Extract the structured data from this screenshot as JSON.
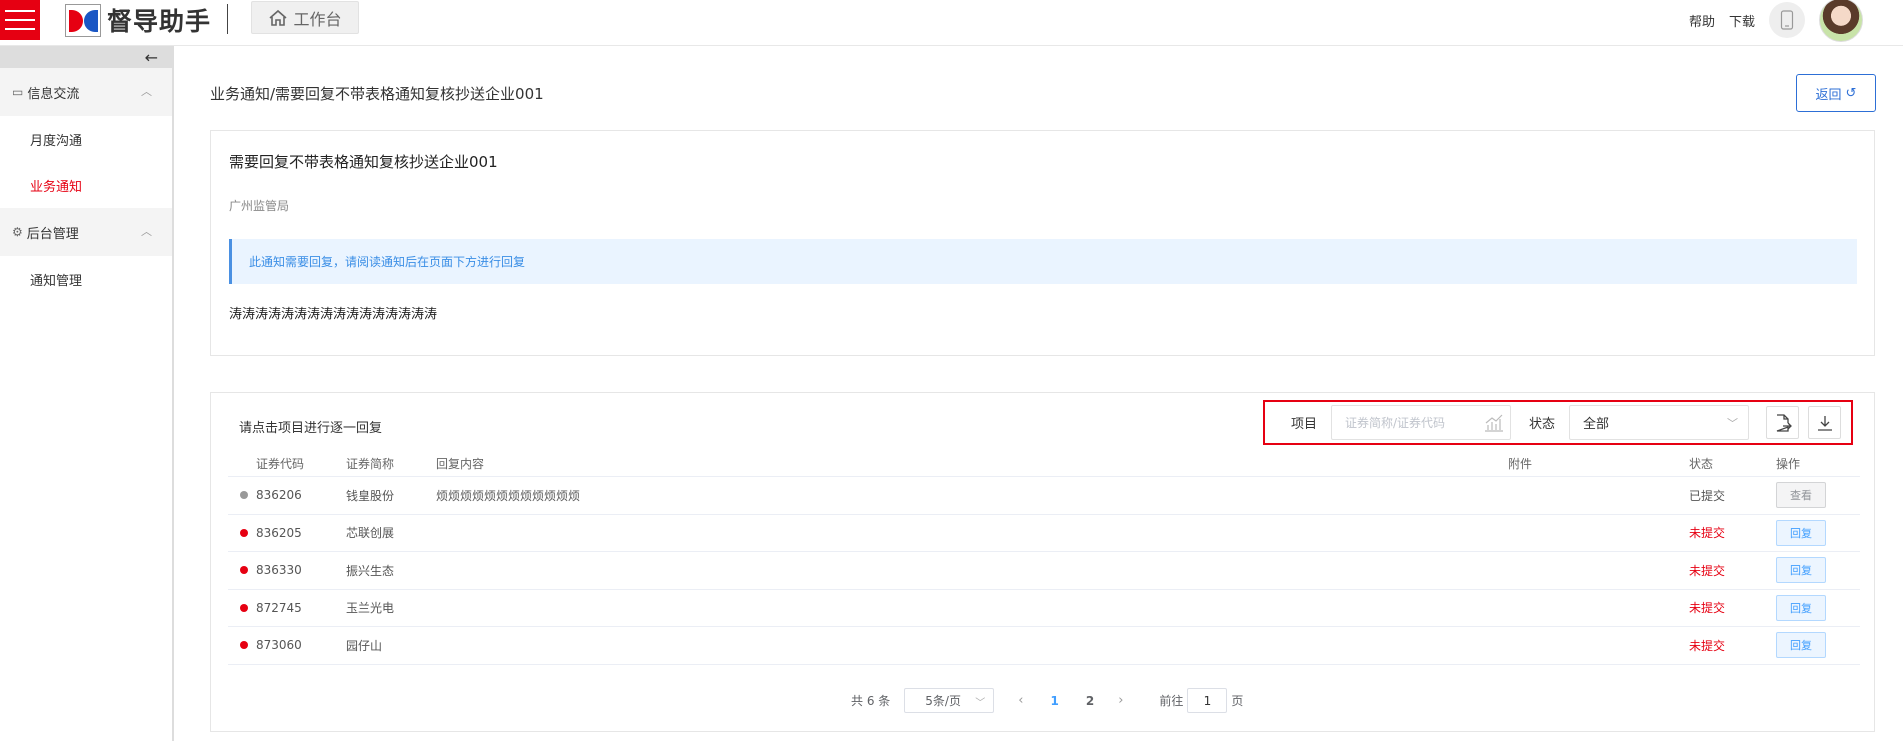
{
  "header": {
    "app_name": "督导助手",
    "home_tab": "工作台",
    "help": "帮助",
    "download": "下载"
  },
  "sidebar": {
    "groups": [
      {
        "label": "信息交流",
        "items": [
          {
            "label": "月度沟通"
          },
          {
            "label": "业务通知",
            "active": true
          }
        ]
      },
      {
        "label": "后台管理",
        "items": [
          {
            "label": "通知管理"
          }
        ]
      }
    ]
  },
  "page": {
    "breadcrumb": "业务通知/需要回复不带表格通知复核抄送企业001",
    "back_label": "返回"
  },
  "notice": {
    "title": "需要回复不带表格通知复核抄送企业001",
    "org": "广州监管局",
    "alert": "此通知需要回复，请阅读通知后在页面下方进行回复",
    "body": "涛涛涛涛涛涛涛涛涛涛涛涛涛涛涛涛"
  },
  "reply": {
    "tip": "请点击项目进行逐一回复",
    "filter": {
      "project_label": "项目",
      "project_placeholder": "证券简称/证券代码",
      "status_label": "状态",
      "status_value": "全部"
    },
    "columns": {
      "code": "证券代码",
      "name": "证券简称",
      "content": "回复内容",
      "attach": "附件",
      "status": "状态",
      "op": "操作"
    },
    "rows": [
      {
        "code": "836206",
        "name": "钱皇股份",
        "content": "烦烦烦烦烦烦烦烦烦烦烦烦",
        "status": "已提交",
        "op": "查看"
      },
      {
        "code": "836205",
        "name": "芯联创展",
        "content": "",
        "status": "未提交",
        "op": "回复"
      },
      {
        "code": "836330",
        "name": "振兴生态",
        "content": "",
        "status": "未提交",
        "op": "回复"
      },
      {
        "code": "872745",
        "name": "玉兰光电",
        "content": "",
        "status": "未提交",
        "op": "回复"
      },
      {
        "code": "873060",
        "name": "园仔山",
        "content": "",
        "status": "未提交",
        "op": "回复"
      }
    ],
    "pager": {
      "total": "共 6 条",
      "page_size": "5条/页",
      "pages": [
        "1",
        "2"
      ],
      "current": "1",
      "goto_label": "前往",
      "goto_value": "1",
      "goto_unit": "页"
    }
  },
  "colors": {
    "brand_red": "#e60012",
    "accent_blue": "#409eff"
  }
}
